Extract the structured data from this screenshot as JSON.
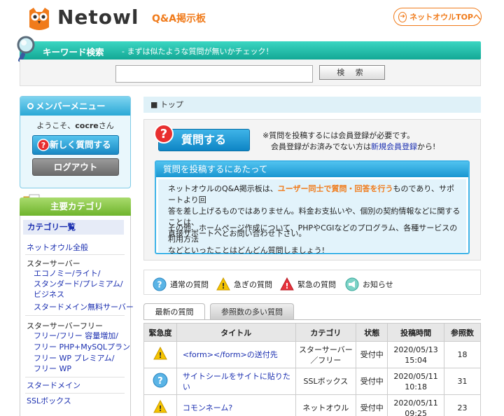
{
  "header": {
    "logo_text": "Netowl",
    "qa_title": "Q&A掲示板",
    "top_link": "ネットオウルTOPへ"
  },
  "search": {
    "title": "キーワード検索",
    "subtitle": "- まずは似たような質問が無いかチェック！",
    "input_value": "",
    "button_label": "検 索"
  },
  "member": {
    "title": "メンバーメニュー",
    "welcome_prefix": "ようこそ、",
    "username": "cocre",
    "welcome_suffix": "さん",
    "new_question": "新しく質問する",
    "logout": "ログアウト"
  },
  "category": {
    "title": "主要カテゴリ",
    "list_title": "カテゴリ一覧",
    "items": [
      {
        "label": "ネットオウル全般"
      },
      {
        "label": "スターサーバー"
      },
      {
        "label": "エコノミー/ライト/"
      },
      {
        "label": "スタンダード/プレミアム/"
      },
      {
        "label": "ビジネス"
      },
      {
        "label": "スタードメイン無料サーバー"
      },
      {
        "label": "スターサーバーフリー"
      },
      {
        "label": "フリー/フリー 容量増加/"
      },
      {
        "label": "フリー PHP+MySQLプラン"
      },
      {
        "label": "フリー WP プレミアム/"
      },
      {
        "label": "フリー WP"
      },
      {
        "label": "スタードメイン"
      },
      {
        "label": "SSLボックス"
      }
    ]
  },
  "breadcrumb": "■ トップ",
  "ask": {
    "button": "質問する",
    "notice_line1": "※質問を投稿するには会員登録が必要です。",
    "notice_line2_a": "会員登録がお済みでない方は",
    "notice_line2_link": "新規会員登録",
    "notice_line2_b": "から!",
    "guide_title": "質問を投稿するにあたって",
    "guide_p1_a": "ネットオウルのQ&A掲示板は、",
    "guide_p1_hl": "ユーザー同士で質問・回答を行う",
    "guide_p1_b": "ものであり、サポートより回",
    "guide_p1_line2": "答を差し上げるものではありません。料金お支払いや、個別の契約情報などに関することは、",
    "guide_p1_line3": "直接サポートへとお問い合わせ下さい。",
    "guide_p2_line1": "その他、ホームページ作成について、PHPやCGIなどのプログラム、各種サービスの利用方法",
    "guide_p2_line2": "などといったことはどんどん質問しましょう!"
  },
  "legend": {
    "normal": "通常の質問",
    "urgent": "急ぎの質問",
    "emergency": "緊急の質問",
    "notice": "お知らせ"
  },
  "tabs": {
    "latest": "最新の質問",
    "popular": "参照数の多い質問"
  },
  "table": {
    "headers": [
      "緊急度",
      "タイトル",
      "カテゴリ",
      "状態",
      "投稿時間",
      "参照数"
    ],
    "rows": [
      {
        "urgency": "urgent",
        "title": "<form></form>の送付先",
        "category_1": "スターサーバー",
        "category_2": "／フリー",
        "status": "受付中",
        "date": "2020/05/13",
        "time": "15:04",
        "views": "18"
      },
      {
        "urgency": "normal",
        "title": "サイトシールをサイトに貼りたい",
        "category_1": "SSLボックス",
        "category_2": "",
        "status": "受付中",
        "date": "2020/05/11",
        "time": "10:18",
        "views": "31"
      },
      {
        "urgency": "urgent",
        "title": "コモンネーム?",
        "category_1": "ネットオウル",
        "category_2": "",
        "status": "受付中",
        "date": "2020/05/11",
        "time": "09:25",
        "views": "23"
      }
    ]
  },
  "colors": {
    "brand_orange": "#f07b1b",
    "search_teal": "#13a895",
    "member_blue": "#2aa8d6",
    "category_green": "#6fb42c",
    "link_blue": "#1b2fb0"
  }
}
